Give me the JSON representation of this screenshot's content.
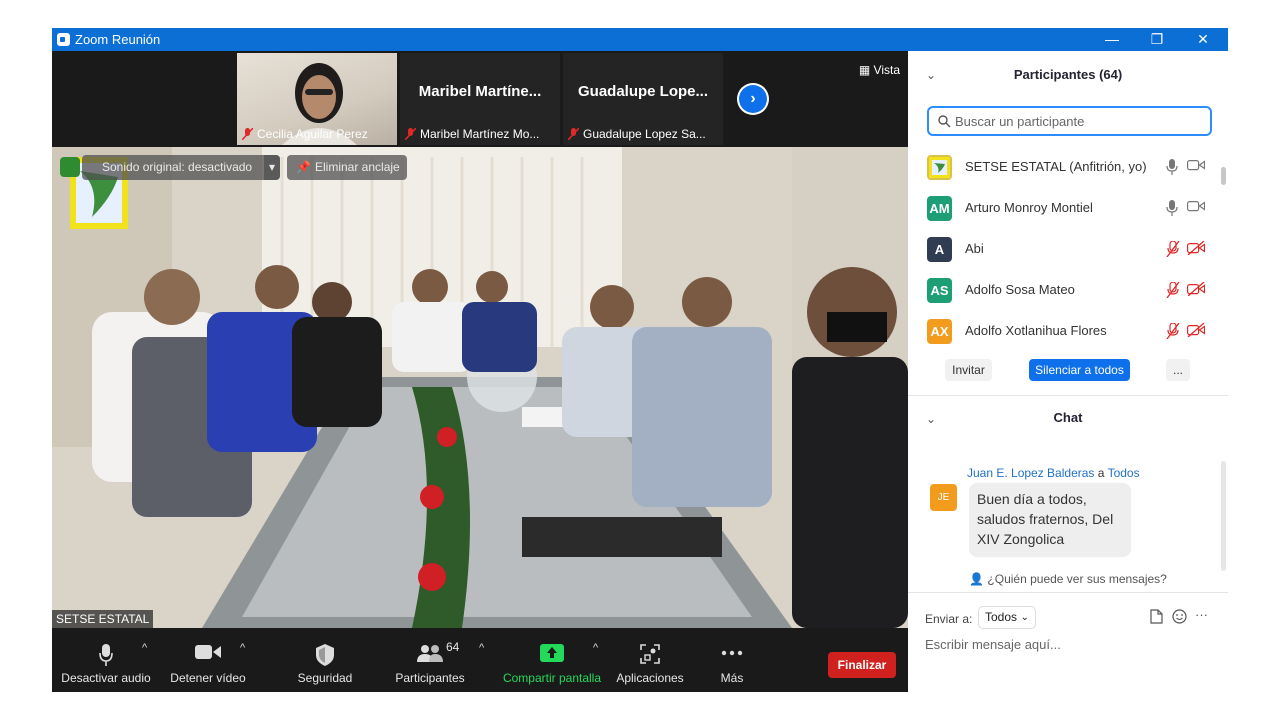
{
  "window": {
    "title": "Zoom Reunión",
    "controls": {
      "minimize": "—",
      "restore": "❐",
      "close": "✕"
    }
  },
  "stage": {
    "view_label": "Vista",
    "thumbnails": [
      {
        "name": "",
        "label": "Cecilia Aguilar Perez",
        "has_video": true
      },
      {
        "name": "Maribel Martíne...",
        "label": "Maribel Martínez Mo...",
        "has_video": false
      },
      {
        "name": "Guadalupe Lope...",
        "label": "Guadalupe Lopez Sa...",
        "has_video": false
      }
    ],
    "overlay": {
      "original_sound": "Sonido original: desactivado",
      "unpin": "Eliminar anclaje"
    },
    "active_speaker_name": "SETSE ESTATAL"
  },
  "toolbar": {
    "mute": "Desactivar audio",
    "video": "Detener vídeo",
    "security": "Seguridad",
    "participants": "Participantes",
    "participants_count": "64",
    "share": "Compartir pantalla",
    "apps": "Aplicaciones",
    "more": "Más",
    "end": "Finalizar",
    "colors": {
      "share_green": "#23d959",
      "end_red": "#d0211f"
    }
  },
  "participants_panel": {
    "title": "Participantes (64)",
    "search_placeholder": "Buscar un participante",
    "rows": [
      {
        "initials": "",
        "name": "SETSE ESTATAL (Anfitrión, yo)",
        "color": "#d8c24a",
        "muted": false,
        "video_off": false
      },
      {
        "initials": "AM",
        "name": "Arturo Monroy Montiel",
        "color": "#1e9e75",
        "muted": false,
        "video_off": false
      },
      {
        "initials": "A",
        "name": "Abi",
        "color": "#2f3c52",
        "muted": true,
        "video_off": true
      },
      {
        "initials": "AS",
        "name": "Adolfo Sosa Mateo",
        "color": "#1e9e75",
        "muted": true,
        "video_off": true
      },
      {
        "initials": "AX",
        "name": "Adolfo Xotlanihua Flores",
        "color": "#f29b1d",
        "muted": true,
        "video_off": true
      }
    ],
    "invite": "Invitar",
    "mute_all": "Silenciar a todos",
    "more": "..."
  },
  "chat": {
    "title": "Chat",
    "messages": [
      {
        "from": "Juan E. Lopez Balderas",
        "to_word": "a",
        "to": "Todos",
        "initials": "JE",
        "text": "Buen día a todos, saludos fraternos, Del XIV Zongolica"
      }
    ],
    "who_can_see": "¿Quién puede ver sus mensajes?",
    "send_to_label": "Enviar a:",
    "send_to_value": "Todos",
    "input_placeholder": "Escribir mensaje aquí...",
    "more": "···"
  }
}
